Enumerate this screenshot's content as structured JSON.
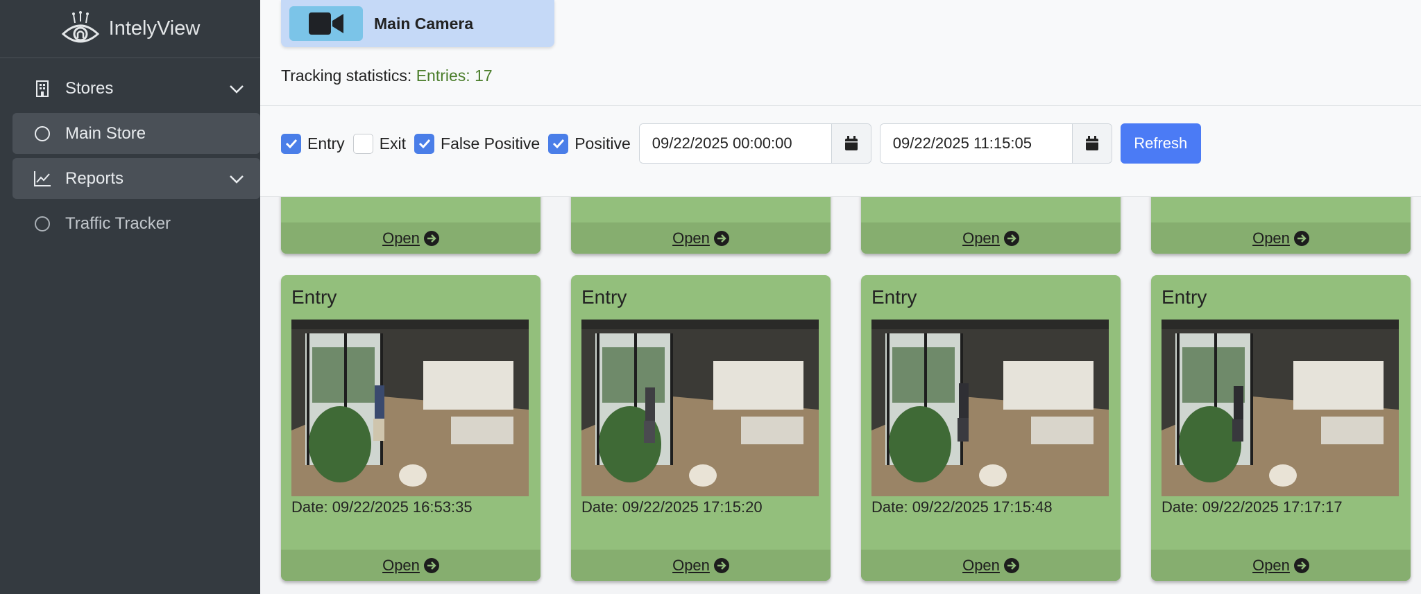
{
  "brand": {
    "name": "IntelyView",
    "logo_icon": "eye-logo-icon"
  },
  "sidebar": {
    "items": [
      {
        "label": "Stores",
        "icon": "building-icon",
        "expandable": true
      },
      {
        "label": "Main Store",
        "icon": "circle-icon",
        "active": true
      },
      {
        "label": "Reports",
        "icon": "chart-line-icon",
        "expandable": true
      },
      {
        "label": "Traffic Tracker",
        "icon": "circle-icon"
      }
    ]
  },
  "camera": {
    "label": "Main Camera",
    "icon": "video-camera-icon"
  },
  "stats": {
    "prefix": "Tracking statistics:",
    "value": "Entries: 17"
  },
  "filters": {
    "checkboxes": [
      {
        "label": "Entry",
        "checked": true
      },
      {
        "label": "Exit",
        "checked": false
      },
      {
        "label": "False Positive",
        "checked": true
      },
      {
        "label": "Positive",
        "checked": true
      }
    ],
    "start_date": "09/22/2025 00:00:00",
    "end_date": "09/22/2025 11:15:05",
    "refresh_label": "Refresh"
  },
  "cards_top": [
    {
      "open_label": "Open"
    },
    {
      "open_label": "Open"
    },
    {
      "open_label": "Open"
    },
    {
      "open_label": "Open"
    }
  ],
  "cards": [
    {
      "title": "Entry",
      "date": "Date: 09/22/2025 16:53:35",
      "open_label": "Open"
    },
    {
      "title": "Entry",
      "date": "Date: 09/22/2025 17:15:20",
      "open_label": "Open"
    },
    {
      "title": "Entry",
      "date": "Date: 09/22/2025 17:15:48",
      "open_label": "Open"
    },
    {
      "title": "Entry",
      "date": "Date: 09/22/2025 17:17:17",
      "open_label": "Open"
    }
  ],
  "colors": {
    "card_bg": "#93bf7c",
    "card_footer": "#86ae6f",
    "accent": "#4b7bf5",
    "sidebar": "#343a40"
  }
}
